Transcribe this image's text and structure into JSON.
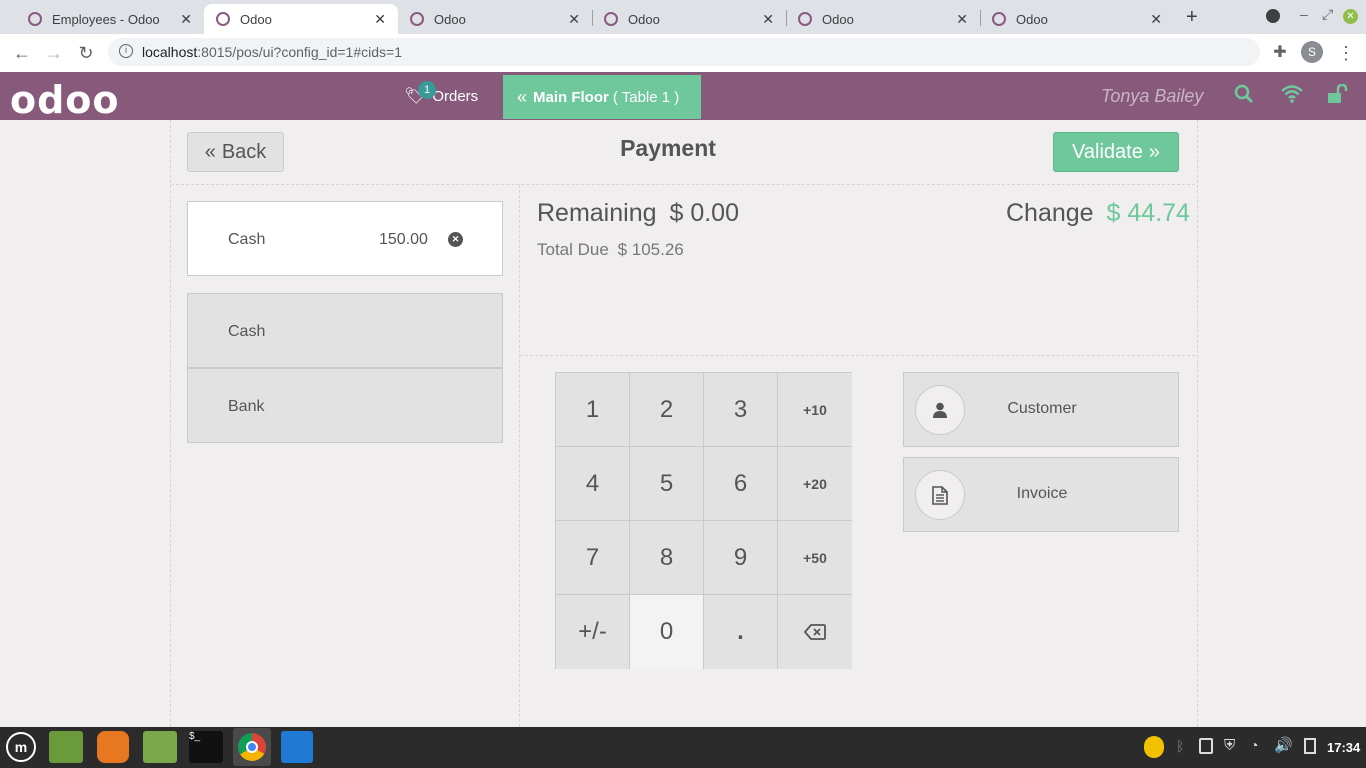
{
  "browser": {
    "tabs": [
      {
        "title": "Employees - Odoo",
        "active": false
      },
      {
        "title": "Odoo",
        "active": true
      },
      {
        "title": "Odoo",
        "active": false
      },
      {
        "title": "Odoo",
        "active": false
      },
      {
        "title": "Odoo",
        "active": false
      },
      {
        "title": "Odoo",
        "active": false
      }
    ],
    "url_host": "localhost",
    "url_rest": ":8015/pos/ui?config_id=1#cids=1",
    "profile_initial": "S"
  },
  "header": {
    "logo": "odoo",
    "orders_label": "Orders",
    "orders_badge": "1",
    "floor_label": "Main Floor",
    "table_label": "( Table 1 )",
    "cashier": "Tonya Bailey"
  },
  "payment": {
    "back_label": "Back",
    "title": "Payment",
    "validate_label": "Validate",
    "paymentline": {
      "method": "Cash",
      "amount": "150.00"
    },
    "methods": [
      "Cash",
      "Bank"
    ],
    "remaining_label": "Remaining",
    "remaining_value": "$ 0.00",
    "change_label": "Change",
    "change_value": "$ 44.74",
    "total_due_label": "Total Due",
    "total_due_value": "$ 105.26",
    "numpad": [
      "1",
      "2",
      "3",
      "+10",
      "4",
      "5",
      "6",
      "+20",
      "7",
      "8",
      "9",
      "+50",
      "+/-",
      "0",
      "."
    ],
    "customer_label": "Customer",
    "invoice_label": "Invoice"
  },
  "colors": {
    "brand": "#875a7b",
    "accent": "#6ec89b"
  },
  "taskbar": {
    "clock": "17:34"
  }
}
